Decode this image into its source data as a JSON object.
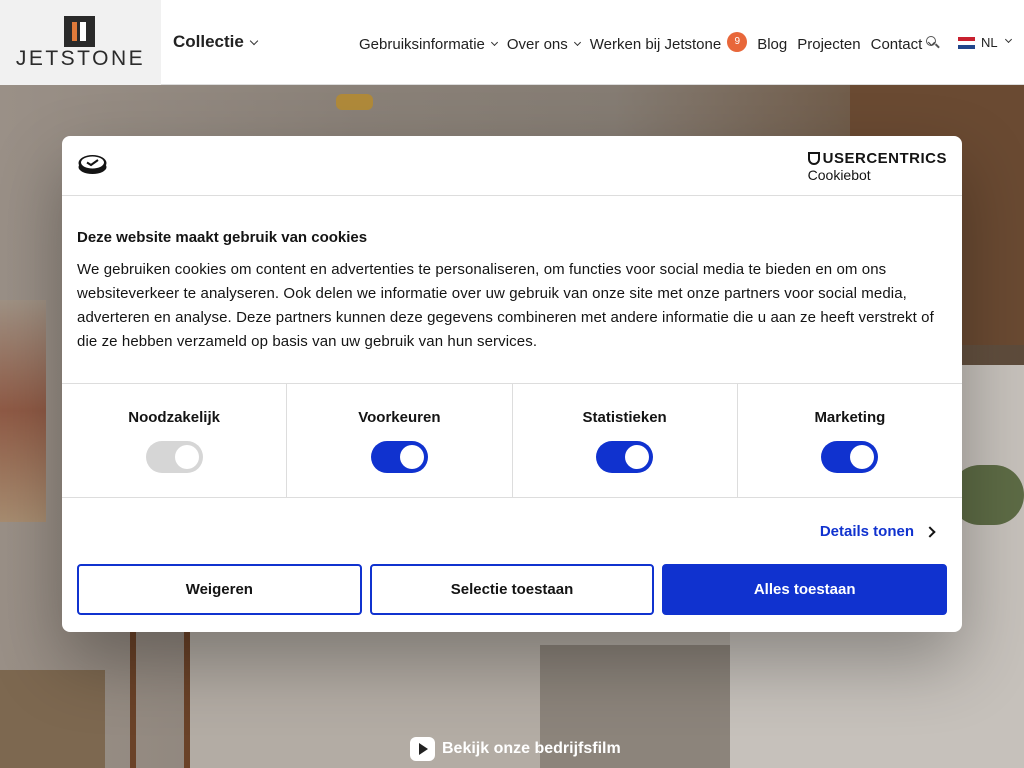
{
  "header": {
    "logo_text": "JETSTONE",
    "collectie_label": "Collectie",
    "nav": [
      {
        "label": "Gebruiksinformatie",
        "has_dropdown": true
      },
      {
        "label": "Over ons",
        "has_dropdown": true
      },
      {
        "label": "Werken bij Jetstone",
        "has_dropdown": false,
        "badge": "9"
      },
      {
        "label": "Blog",
        "has_dropdown": false
      },
      {
        "label": "Projecten",
        "has_dropdown": false
      },
      {
        "label": "Contact",
        "has_dropdown": true
      }
    ],
    "language": "NL",
    "icons": {
      "search": "search-icon",
      "flag": "netherlands-flag-icon"
    },
    "colors": {
      "badge": "#e8673a",
      "logo_accent": "#e07a3a"
    }
  },
  "hero": {
    "video_link_label": "Bekijk onze bedrijfsfilm"
  },
  "cookie_dialog": {
    "brand": "USERCENTRICS",
    "brand_sub": "Cookiebot",
    "title": "Deze website maakt gebruik van cookies",
    "text": "We gebruiken cookies om content en advertenties te personaliseren, om functies voor social media te bieden en om ons websiteverkeer te analyseren. Ook delen we informatie over uw gebruik van onze site met onze partners voor social media, adverteren en analyse. Deze partners kunnen deze gegevens combineren met andere informatie die u aan ze heeft verstrekt of die ze hebben verzameld op basis van uw gebruik van hun services.",
    "toggles": [
      {
        "label": "Noodzakelijk",
        "on": true,
        "disabled": true
      },
      {
        "label": "Voorkeuren",
        "on": true,
        "disabled": false
      },
      {
        "label": "Statistieken",
        "on": true,
        "disabled": false
      },
      {
        "label": "Marketing",
        "on": true,
        "disabled": false
      }
    ],
    "details_label": "Details tonen",
    "buttons": {
      "reject": "Weigeren",
      "selection": "Selectie toestaan",
      "accept_all": "Alles toestaan"
    },
    "colors": {
      "accent": "#1032cf"
    }
  }
}
